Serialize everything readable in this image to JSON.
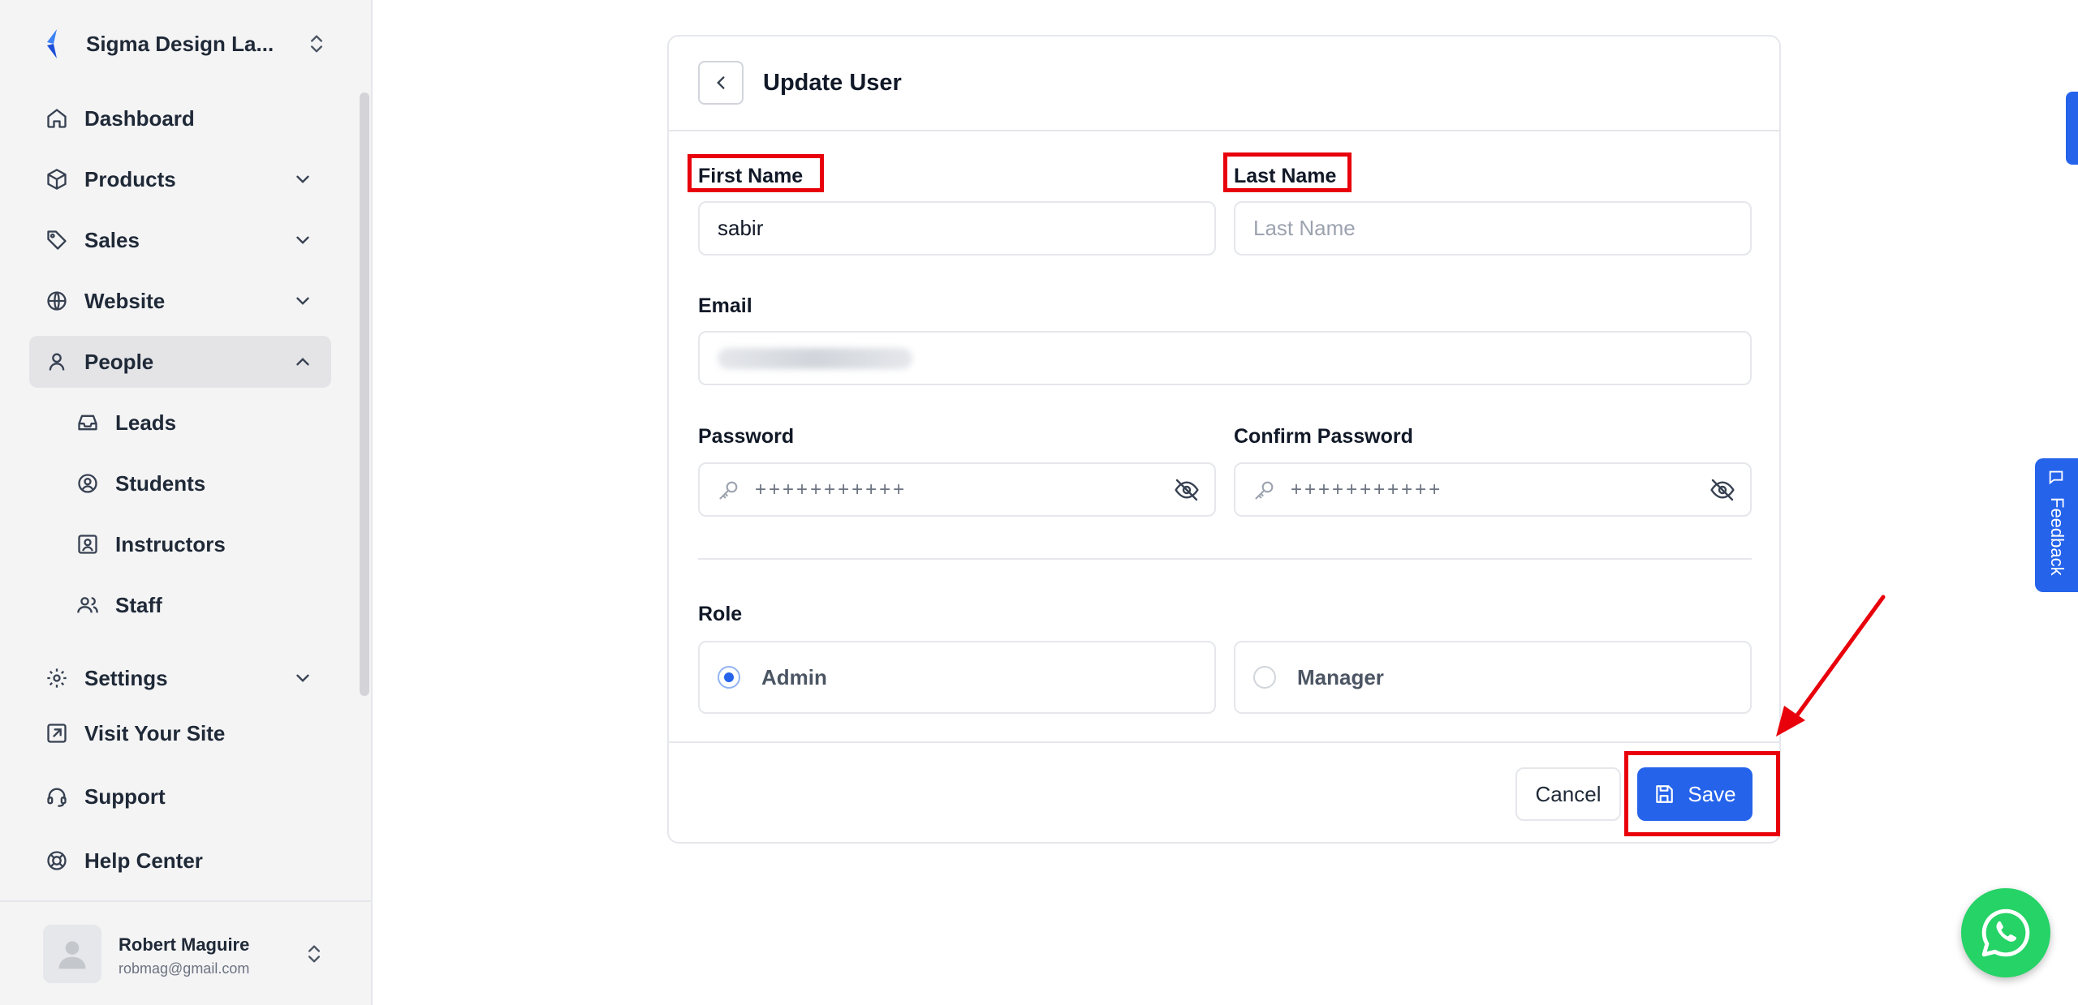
{
  "sidebar": {
    "brand": "Sigma Design La...",
    "items": [
      {
        "label": "Dashboard"
      },
      {
        "label": "Products"
      },
      {
        "label": "Sales"
      },
      {
        "label": "Website"
      },
      {
        "label": "People"
      },
      {
        "label": "Leads"
      },
      {
        "label": "Students"
      },
      {
        "label": "Instructors"
      },
      {
        "label": "Staff"
      },
      {
        "label": "Settings"
      },
      {
        "label": "Visit Your Site"
      },
      {
        "label": "Support"
      },
      {
        "label": "Help Center"
      }
    ],
    "user": {
      "name": "Robert Maguire",
      "email": "robmag@gmail.com"
    }
  },
  "form": {
    "title": "Update User",
    "first_name": {
      "label": "First Name",
      "value": "sabir"
    },
    "last_name": {
      "label": "Last Name",
      "placeholder": "Last Name"
    },
    "email": {
      "label": "Email"
    },
    "password": {
      "label": "Password",
      "value": "+++++++++++"
    },
    "confirm_password": {
      "label": "Confirm Password",
      "value": "+++++++++++"
    },
    "role": {
      "label": "Role",
      "options": [
        "Admin",
        "Manager"
      ],
      "selected": "Admin"
    },
    "cancel_label": "Cancel",
    "save_label": "Save"
  },
  "feedback_label": "Feedback",
  "colors": {
    "accent": "#2563eb",
    "highlight": "#e8000b",
    "whatsapp": "#25d366"
  }
}
